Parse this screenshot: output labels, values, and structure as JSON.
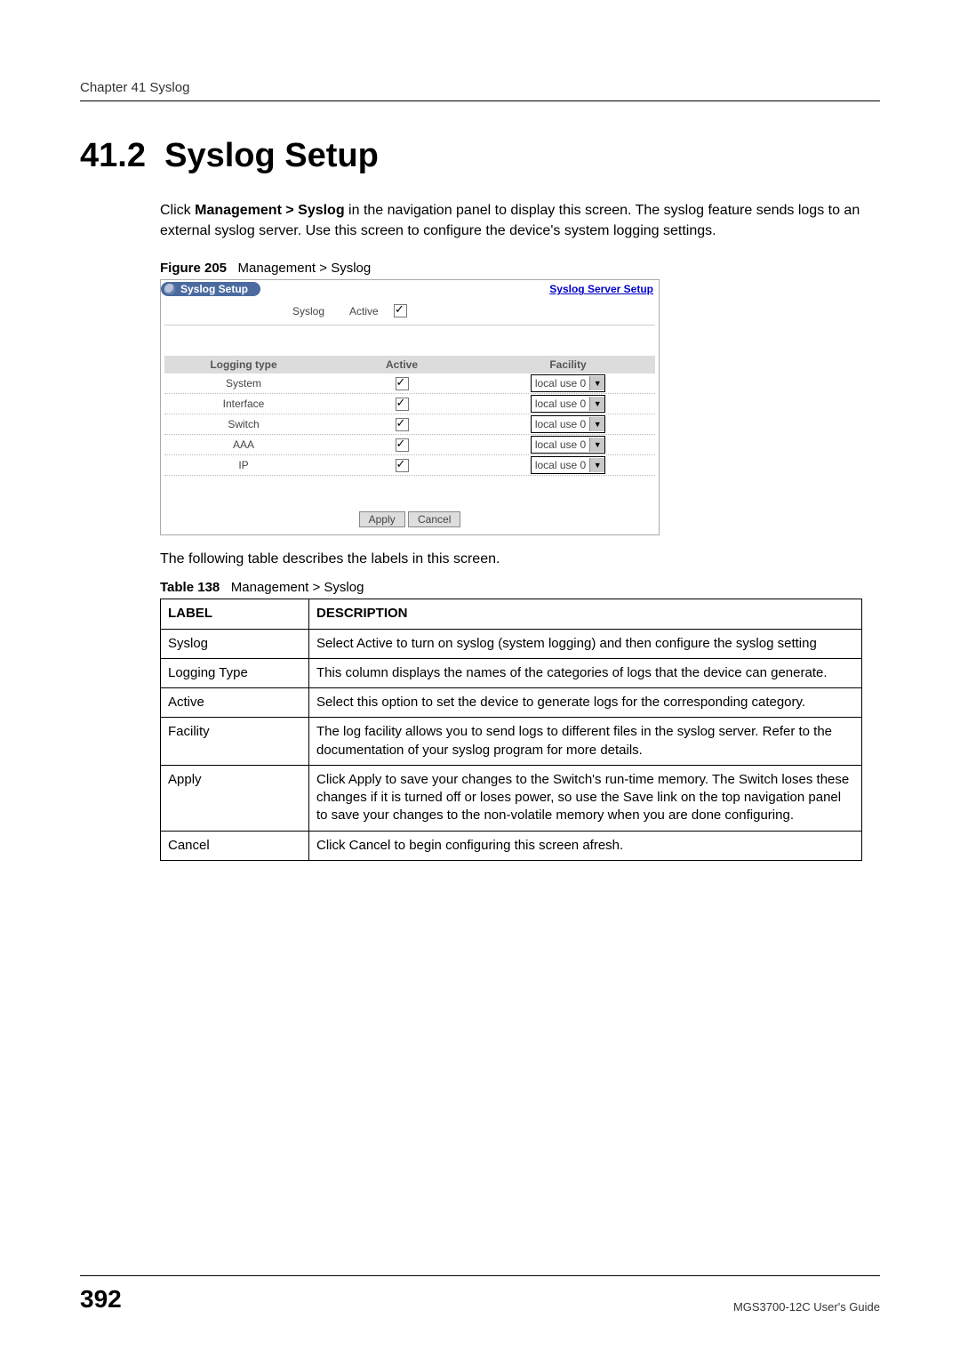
{
  "header": {
    "running": "Chapter 41 Syslog"
  },
  "section": {
    "number": "41.2",
    "title": "Syslog Setup"
  },
  "intro": {
    "pre": "Click ",
    "path": "Management > Syslog",
    "post": " in the navigation panel to display this screen. The syslog feature sends logs to an external syslog server. Use this screen to configure the device's system logging settings."
  },
  "figure": {
    "caption_label": "Figure 205",
    "caption_text": "Management > Syslog",
    "panel_title": "Syslog Setup",
    "link_text": "Syslog Server Setup",
    "syslog_label": "Syslog",
    "active_label": "Active",
    "syslog_active_checked": true,
    "columns": {
      "c1": "Logging type",
      "c2": "Active",
      "c3": "Facility"
    },
    "rows": [
      {
        "name": "System",
        "active": true,
        "facility": "local use 0"
      },
      {
        "name": "Interface",
        "active": true,
        "facility": "local use 0"
      },
      {
        "name": "Switch",
        "active": true,
        "facility": "local use 0"
      },
      {
        "name": "AAA",
        "active": true,
        "facility": "local use 0"
      },
      {
        "name": "IP",
        "active": true,
        "facility": "local use 0"
      }
    ],
    "apply_btn": "Apply",
    "cancel_btn": "Cancel"
  },
  "desc_intro": "The following table describes the labels in this screen.",
  "table_caption": {
    "label": "Table 138",
    "text": "Management > Syslog"
  },
  "table_head": {
    "c1": "LABEL",
    "c2": "DESCRIPTION"
  },
  "table_rows": [
    {
      "label": "Syslog",
      "desc": "Select Active to turn on syslog (system logging) and then configure the syslog setting"
    },
    {
      "label": "Logging Type",
      "desc": "This column displays the names of the categories of logs that the device can generate."
    },
    {
      "label": "Active",
      "desc": "Select this option to set the device to generate logs for the corresponding category."
    },
    {
      "label": "Facility",
      "desc": "The log facility allows you to send logs to different files in the syslog server. Refer to the documentation of your syslog program for more details."
    },
    {
      "label": "Apply",
      "desc": "Click Apply to save your changes to the Switch's run-time memory. The Switch loses these changes if it is turned off or loses power, so use the Save link on the top navigation panel to save your changes to the non-volatile memory when you are done configuring."
    },
    {
      "label": "Cancel",
      "desc": "Click Cancel to begin configuring this screen afresh."
    }
  ],
  "footer": {
    "page": "392",
    "guide": "MGS3700-12C User's Guide"
  }
}
